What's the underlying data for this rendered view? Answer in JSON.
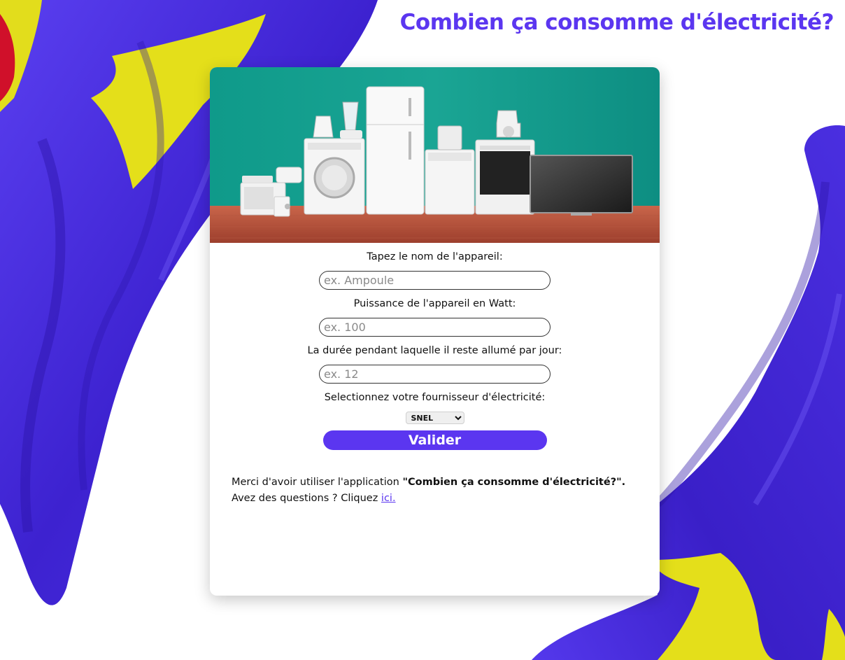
{
  "colors": {
    "accent": "#5b36f0",
    "flag_blue": "#4a2fe0",
    "flag_yellow": "#e6e11a",
    "flag_red": "#d0102a"
  },
  "header": {
    "title": "Combien ça consomme d'électricité?"
  },
  "hero": {
    "alt": "Appareils électroménagers"
  },
  "form": {
    "device_name": {
      "label": "Tapez le nom de l'appareil:",
      "placeholder": "ex. Ampoule",
      "value": ""
    },
    "power": {
      "label": "Puissance de l'appareil en Watt:",
      "placeholder": "ex. 100",
      "value": ""
    },
    "duration": {
      "label": "La durée pendant laquelle il reste allumé par jour:",
      "placeholder": "ex. 12",
      "value": ""
    },
    "provider": {
      "label": "Selectionnez votre fournisseur d'électricité:",
      "selected": "SNEL",
      "options": [
        "SNEL"
      ]
    },
    "submit_label": "Valider"
  },
  "footer": {
    "thanks_prefix": "Merci d'avoir utiliser l'application ",
    "app_name": "\"Combien ça consomme d'électricité?\".",
    "questions_prefix": "Avez des questions ? Cliquez ",
    "link_label": "ici."
  }
}
